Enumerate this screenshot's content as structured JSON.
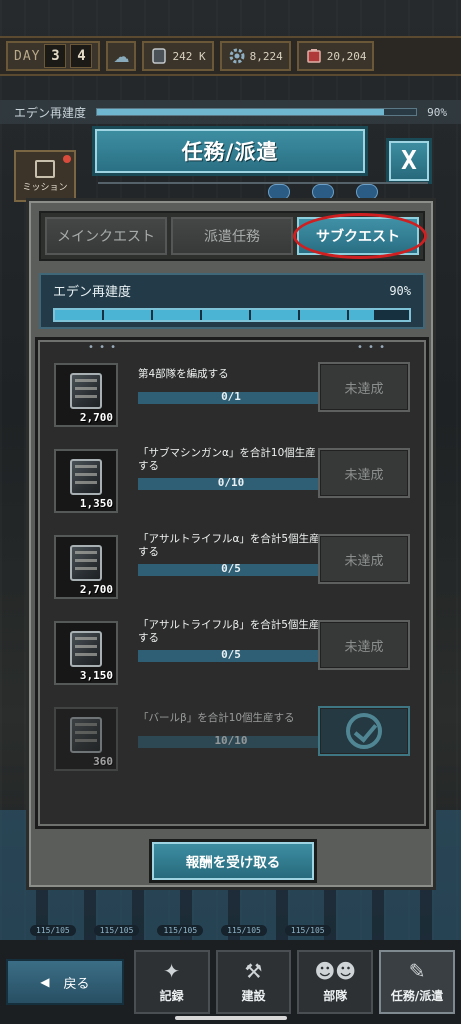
{
  "topbar": {
    "day_label": "DAY",
    "day_digits": [
      "3",
      "4"
    ],
    "resources": [
      {
        "icon": "metal-cube-icon",
        "value": "242 K"
      },
      {
        "icon": "gear-parts-icon",
        "value": "8,224"
      },
      {
        "icon": "energy-battery-icon",
        "value": "20,204"
      }
    ]
  },
  "background": {
    "eden_label": "エデン再建度",
    "eden_pct": "90%",
    "mission_label": "ミッション",
    "factory_stats": [
      "115/105",
      "115/105",
      "115/105",
      "115/105",
      "115/105"
    ]
  },
  "dialog": {
    "title": "任務/派遣",
    "close_label": "X",
    "tabs": [
      {
        "label": "メインクエスト",
        "active": false
      },
      {
        "label": "派遣任務",
        "active": false
      },
      {
        "label": "サブクエスト",
        "active": true
      }
    ],
    "progress": {
      "label": "エデン再建度",
      "pct_text": "90%",
      "value": 0.9
    },
    "quests": [
      {
        "title": "第4部隊を編成する",
        "reward": "2,700",
        "progress": "0/1",
        "status": "未達成",
        "done": false
      },
      {
        "title": "「サブマシンガンα」を合計10個生産する",
        "reward": "1,350",
        "progress": "0/10",
        "status": "未達成",
        "done": false
      },
      {
        "title": "「アサルトライフルα」を合計5個生産する",
        "reward": "2,700",
        "progress": "0/5",
        "status": "未達成",
        "done": false
      },
      {
        "title": "「アサルトライフルβ」を合計5個生産する",
        "reward": "3,150",
        "progress": "0/5",
        "status": "未達成",
        "done": false
      },
      {
        "title": "「バールβ」を合計10個生産する",
        "reward": "360",
        "progress": "10/10",
        "status": "",
        "done": true
      }
    ],
    "claim_label": "報酬を受け取る"
  },
  "nav": {
    "back_label": "戻る",
    "items": [
      {
        "label": "記録",
        "icon": "compass-star-icon"
      },
      {
        "label": "建設",
        "icon": "hammer-icon"
      },
      {
        "label": "部隊",
        "icon": "squad-people-icon"
      },
      {
        "label": "任務/派遣",
        "icon": "mission-scroll-icon"
      }
    ]
  },
  "colors": {
    "accent": "#3e8fa3",
    "highlight_circle": "#d01f20",
    "progress_fill": "#4bb3d4"
  }
}
